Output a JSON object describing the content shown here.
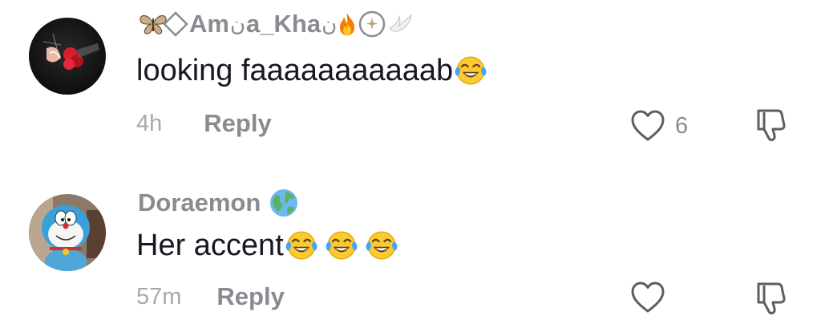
{
  "comments": [
    {
      "username_part1": "Am",
      "username_part2": "ن",
      "username_part3": "a_Kha",
      "username_part4": "ن",
      "text": "looking faaaaaaaaaaab",
      "time": "4h",
      "reply_label": "Reply",
      "like_count": "6",
      "emoji_count": 1,
      "avatar_icon": "dark-floral-photo"
    },
    {
      "username": "Doraemon",
      "text": "Her accent",
      "time": "57m",
      "reply_label": "Reply",
      "like_count": "",
      "emoji_count": 3,
      "avatar_icon": "doraemon-toy-photo"
    }
  ],
  "colors": {
    "text_primary": "#161823",
    "text_secondary": "#8a8b91",
    "text_tertiary": "#a8a9ad",
    "emoji_face": "#fbc02d",
    "tear": "#42a5f5"
  }
}
